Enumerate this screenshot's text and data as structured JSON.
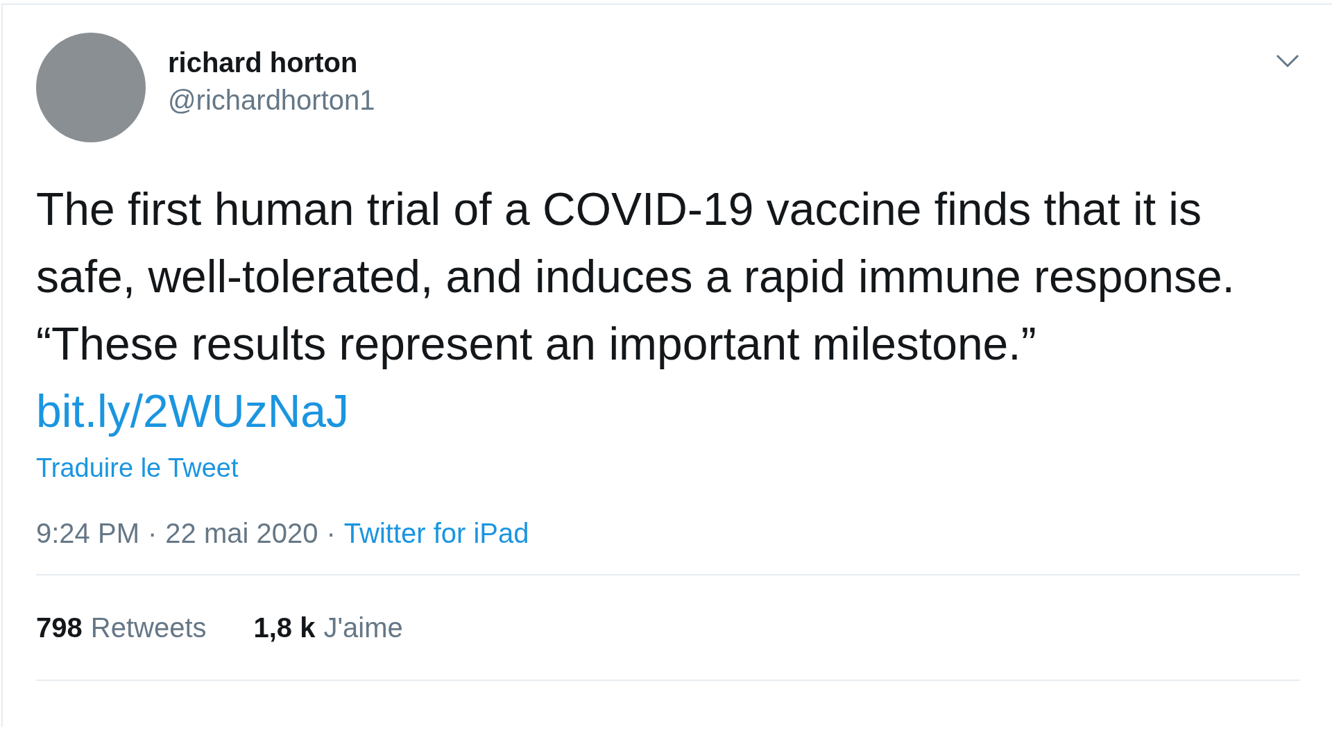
{
  "author": {
    "name": "richard horton",
    "handle": "@richardhorton1"
  },
  "tweet": {
    "text": "The first human trial of a COVID-19 vaccine finds that it is safe, well-tolerated, and induces a rapid immune response.   “These results represent an important milestone.”   ",
    "link": "bit.ly/2WUzNaJ",
    "translate": "Traduire le Tweet"
  },
  "meta": {
    "time": "9:24 PM",
    "separator": "·",
    "date": "22 mai 2020",
    "separator_2": "·",
    "source": "Twitter for iPad"
  },
  "stats": [
    {
      "count": "798",
      "label": "Retweets"
    },
    {
      "count": "1,8 k",
      "label": "J'aime"
    }
  ]
}
